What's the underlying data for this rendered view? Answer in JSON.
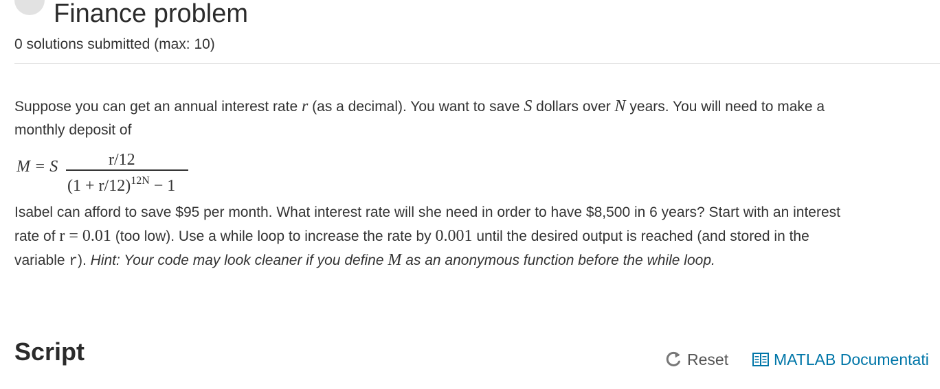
{
  "header": {
    "title": "Finance problem",
    "submissions": "0 solutions submitted (max: 10)"
  },
  "problem": {
    "p1_a": "Suppose you can get an annual interest rate ",
    "var_r": "r",
    "p1_b": " (as a decimal). You want to save ",
    "var_S": "S",
    "p1_c": " dollars over ",
    "var_N": "N",
    "p1_d": " years. You will need to make a",
    "p1_line2": "monthly deposit of",
    "formula": {
      "lhs": "M = S",
      "numerator": "r/12",
      "denominator_base": "(1 + r/12)",
      "denominator_exp": "12N",
      "denominator_tail": " − 1"
    },
    "p3_line1": "Isabel can afford to save $95 per month. What interest rate will she need in order to have $8,500 in 6 years? Start with an interest",
    "p3_a": "rate of ",
    "initial_rate": "r = 0.01",
    "p3_b": " (too low). Use a while loop to increase the rate by ",
    "increment": "0.001",
    "p3_c": " until the desired output is reached (and stored in the",
    "p3_d": "variable ",
    "code_var": "r",
    "p3_e": "). ",
    "hint_a": "Hint: Your code may look cleaner if you define ",
    "var_M": "M",
    "hint_b": " as an anonymous function before the while loop."
  },
  "script_section": {
    "heading": "Script",
    "reset_label": "Reset",
    "docs_label": "MATLAB Documentati"
  },
  "icons": {
    "status": "status-circle-icon",
    "reset": "reset-icon",
    "docs": "book-icon"
  },
  "colors": {
    "link": "#0076a8",
    "status_circle": "#e2e2e2"
  }
}
